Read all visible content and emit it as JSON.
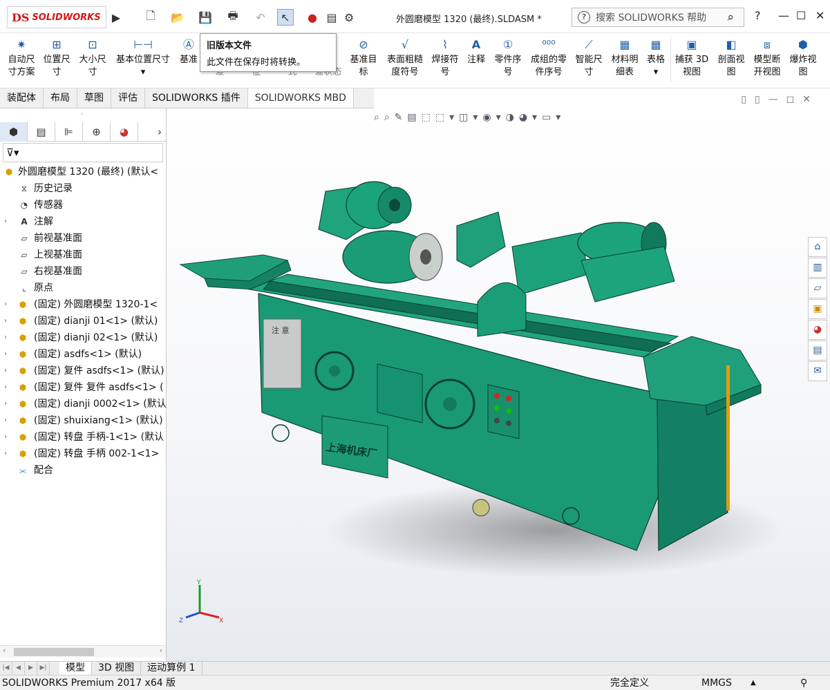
{
  "app": {
    "logo_ds": "DS",
    "logo_name": "SOLIDWORKS",
    "window_title": "外圆磨模型 1320 (最终).SLDASM *",
    "search_placeholder": "搜索 SOLIDWORKS 帮助",
    "help": "?",
    "accent": "#d01818"
  },
  "tooltip": {
    "title": "旧版本文件",
    "body": "此文件在保存时将转换。"
  },
  "commands": [
    {
      "line1": "自动尺",
      "line2": "寸方案",
      "icon": "auto-dimension-icon"
    },
    {
      "line1": "位置尺",
      "line2": "寸",
      "icon": "location-dimension-icon"
    },
    {
      "line1": "大小尺",
      "line2": "寸",
      "icon": "size-dimension-icon"
    },
    {
      "line1": "基本位置尺寸",
      "line2": "",
      "icon": "basic-location-dimension-icon"
    },
    {
      "line1": "基准",
      "line2": "",
      "icon": "datum-icon"
    },
    {
      "line1": "",
      "line2": "差",
      "icon": "tolerance-icon"
    },
    {
      "line1": "",
      "line2": "征",
      "icon": "feature-icon"
    },
    {
      "line1": "",
      "line2": "式",
      "icon": "style-icon"
    },
    {
      "line1": "",
      "line2": "差状态",
      "icon": "tolerance-status-icon"
    },
    {
      "line1": "基准目",
      "line2": "标",
      "icon": "datum-target-icon"
    },
    {
      "line1": "表面粗糙",
      "line2": "度符号",
      "icon": "surface-finish-icon"
    },
    {
      "line1": "焊接符",
      "line2": "号",
      "icon": "weld-symbol-icon"
    },
    {
      "line1": "注释",
      "line2": "",
      "icon": "note-icon"
    },
    {
      "line1": "零件序",
      "line2": "号",
      "icon": "balloon-icon"
    },
    {
      "line1": "成组的零",
      "line2": "件序号",
      "icon": "stacked-balloon-icon"
    },
    {
      "line1": "智能尺",
      "line2": "寸",
      "icon": "smart-dimension-icon"
    },
    {
      "line1": "材料明",
      "line2": "细表",
      "icon": "bom-icon"
    },
    {
      "line1": "表格",
      "line2": "",
      "icon": "table-icon"
    },
    {
      "line1": "捕获 3D",
      "line2": "视图",
      "icon": "capture-3d-view-icon"
    },
    {
      "line1": "剖面视",
      "line2": "图",
      "icon": "section-view-icon"
    },
    {
      "line1": "模型断",
      "line2": "开视图",
      "icon": "model-break-view-icon"
    },
    {
      "line1": "爆炸视",
      "line2": "图",
      "icon": "explode-view-icon"
    }
  ],
  "tabs": [
    "装配体",
    "布局",
    "草图",
    "评估",
    "SOLIDWORKS 插件",
    "SOLIDWORKS MBD"
  ],
  "active_tab": "SOLIDWORKS MBD",
  "tree": [
    {
      "label": "外圆磨模型 1320 (最终)  (默认<",
      "icon": "assembly-icon",
      "expand": false
    },
    {
      "label": "历史记录",
      "icon": "history-icon",
      "expand": false
    },
    {
      "label": "传感器",
      "icon": "sensor-icon",
      "expand": false
    },
    {
      "label": "注解",
      "icon": "annotation-icon",
      "expand": true
    },
    {
      "label": "前视基准面",
      "icon": "plane-icon",
      "expand": false
    },
    {
      "label": "上视基准面",
      "icon": "plane-icon",
      "expand": false
    },
    {
      "label": "右视基准面",
      "icon": "plane-icon",
      "expand": false
    },
    {
      "label": "原点",
      "icon": "origin-icon",
      "expand": false
    },
    {
      "label": "(固定) 外圆磨模型 1320-1<",
      "icon": "component-icon",
      "expand": true
    },
    {
      "label": "(固定) dianji 01<1> (默认)",
      "icon": "component-icon",
      "expand": true
    },
    {
      "label": "(固定) dianji 02<1> (默认)",
      "icon": "component-icon",
      "expand": true
    },
    {
      "label": "(固定) asdfs<1> (默认)",
      "icon": "component-icon",
      "expand": true
    },
    {
      "label": "(固定) 复件 asdfs<1> (默认)",
      "icon": "component-icon",
      "expand": true
    },
    {
      "label": "(固定) 复件 复件 asdfs<1> (",
      "icon": "component-icon",
      "expand": true
    },
    {
      "label": "(固定) dianji 0002<1> (默认",
      "icon": "component-icon",
      "expand": true
    },
    {
      "label": "(固定) shuixiang<1> (默认)",
      "icon": "component-icon",
      "expand": true
    },
    {
      "label": "(固定) 转盘 手柄-1<1> (默认",
      "icon": "component-icon",
      "expand": true
    },
    {
      "label": "(固定) 转盘 手柄 002-1<1>",
      "icon": "component-icon",
      "expand": true
    },
    {
      "label": "配合",
      "icon": "mates-icon",
      "expand": false
    }
  ],
  "bottom_tabs": [
    "模型",
    "3D 视图",
    "运动算例 1"
  ],
  "status": {
    "left": "SOLIDWORKS Premium 2017 x64 版",
    "state": "完全定义",
    "units": "MMGS"
  },
  "model": {
    "plate_left": "注 意",
    "plate_name": "上海机床厂",
    "body_color": "#1a9a74",
    "triad_x": "X",
    "triad_y": "Y",
    "triad_z": "Z"
  }
}
